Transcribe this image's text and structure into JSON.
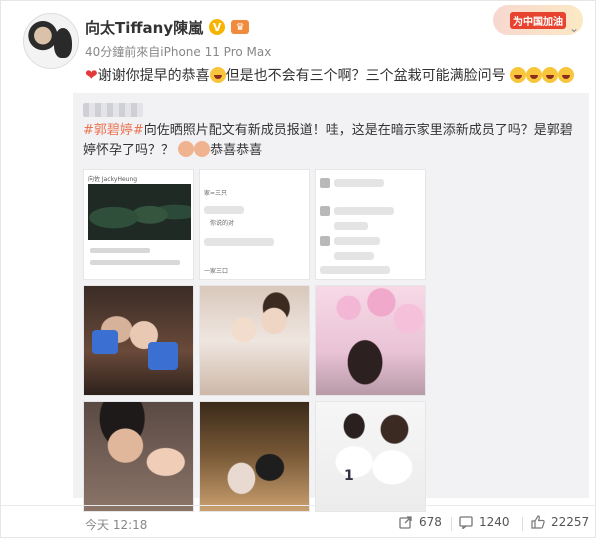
{
  "header": {
    "username": "向太Tiffany陳嵐",
    "verified_badge": "V",
    "meta": "40分鐘前來自iPhone 11 Pro Max",
    "promo_label": "为中国加油"
  },
  "post": {
    "text_before": "谢谢你提早的恭喜",
    "text_middle": "但是也不会有三个啊？三个盆栽可能满脸问号"
  },
  "repost": {
    "hashtag": "#郭碧婷#",
    "text": "向佐晒照片配文有新成员报道！哇，这是在暗示家里添新成员了吗？是郭碧婷怀孕了吗？？",
    "text_end": "恭喜恭喜",
    "screenshot_texts": {
      "one": "向佐 JackyHeung",
      "two_a": "家=三只",
      "two_b": "你说的对",
      "two_c": "一家三口",
      "three_a": "",
      "three_b": ""
    },
    "jersey_number": "1"
  },
  "footer": {
    "time": "今天 12:18",
    "repost_count": "678",
    "comment_count": "1240",
    "like_count": "22257"
  },
  "colors": {
    "hashtag": "#eb7350",
    "heart": "#e4393c"
  }
}
